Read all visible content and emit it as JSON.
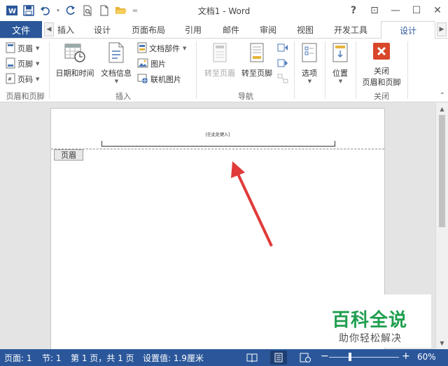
{
  "title": "文档1 - Word",
  "window_controls": {
    "help": "?",
    "restore_ribbon": "⊡",
    "minimize": "—",
    "maximize": "☐",
    "close": "✕"
  },
  "qat": {
    "customize": "="
  },
  "tabs": [
    {
      "label": "文件"
    },
    {
      "label": "插入"
    },
    {
      "label": "设计"
    },
    {
      "label": "页面布局"
    },
    {
      "label": "引用"
    },
    {
      "label": "邮件"
    },
    {
      "label": "审阅"
    },
    {
      "label": "视图"
    },
    {
      "label": "开发工具"
    },
    {
      "label": "设计"
    }
  ],
  "ribbon": {
    "group_header_footer": {
      "label": "页眉和页脚",
      "header": "页眉",
      "footer": "页脚",
      "page_number": "页码"
    },
    "group_insert": {
      "label": "插入",
      "date_time": "日期和时间",
      "doc_info": "文档信息",
      "quick_parts": "文档部件",
      "pictures": "图片",
      "online_pictures": "联机图片"
    },
    "group_nav": {
      "label": "导航",
      "goto_header": "转至页眉",
      "goto_footer": "转至页脚"
    },
    "group_options": {
      "options": "选项"
    },
    "group_position": {
      "position": "位置"
    },
    "group_close": {
      "label": "关闭",
      "close_line1": "关闭",
      "close_line2": "页眉和页脚"
    }
  },
  "document": {
    "header_placeholder": "[在此处键入]",
    "header_tag": "页眉"
  },
  "watermark": {
    "title": "百科全说",
    "subtitle": "助你轻松解决"
  },
  "statusbar": {
    "page": "页面: 1",
    "section": "节: 1",
    "page_of": "第 1 页，共 1 页",
    "setting": "设置值: 1.9厘米",
    "zoom_minus": "−",
    "zoom_plus": "+",
    "zoom": "60%"
  },
  "colors": {
    "accent": "#2b579a",
    "close_red": "#d9472b",
    "watermark_green": "#1f9e4f"
  }
}
